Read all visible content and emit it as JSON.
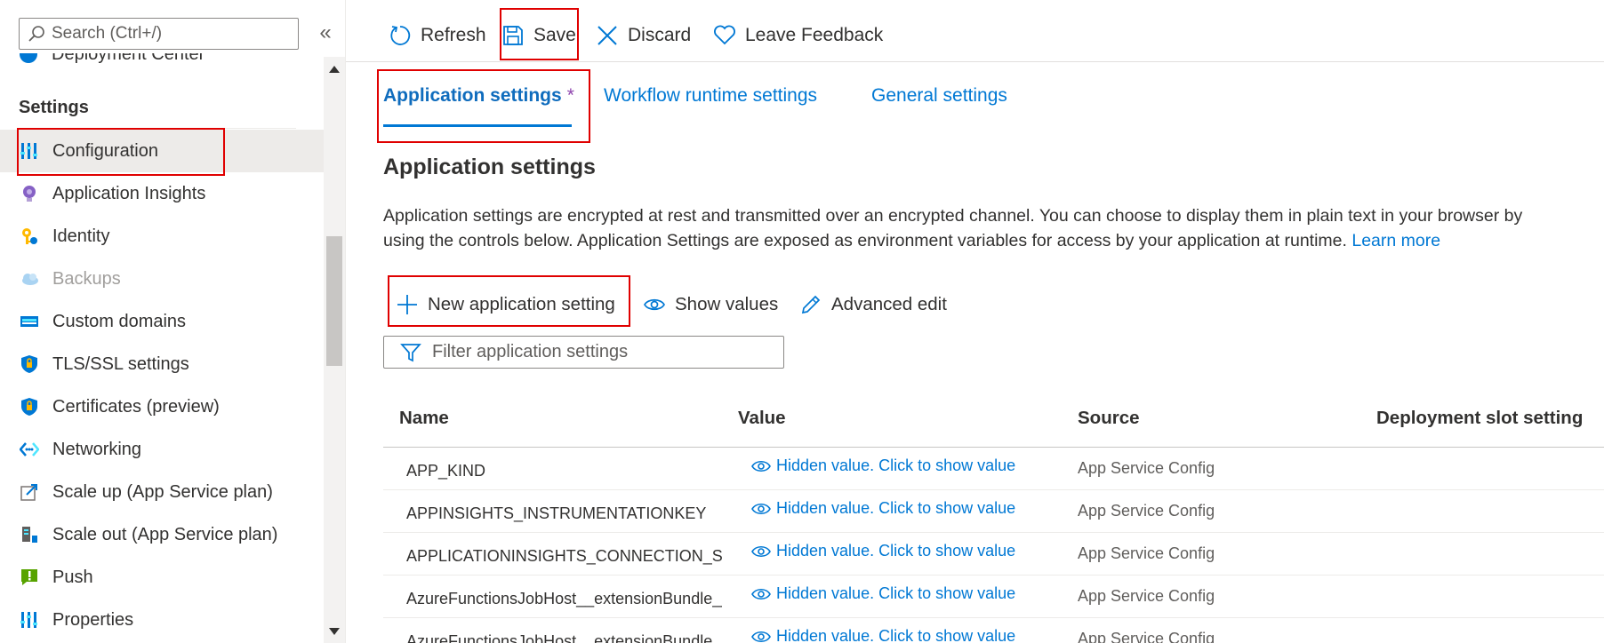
{
  "sidebar": {
    "search_placeholder": "Search (Ctrl+/)",
    "collapse_glyph": "«",
    "partial_item": "Deployment Center",
    "section_header": "Settings",
    "items": [
      {
        "label": "Configuration",
        "icon": "configuration-icon",
        "selected": true
      },
      {
        "label": "Application Insights",
        "icon": "lightbulb-icon"
      },
      {
        "label": "Identity",
        "icon": "identity-key-icon"
      },
      {
        "label": "Backups",
        "icon": "cloud-icon",
        "disabled": true
      },
      {
        "label": "Custom domains",
        "icon": "domain-icon"
      },
      {
        "label": "TLS/SSL settings",
        "icon": "shield-icon"
      },
      {
        "label": "Certificates (preview)",
        "icon": "certificate-shield-icon"
      },
      {
        "label": "Networking",
        "icon": "networking-icon"
      },
      {
        "label": "Scale up (App Service plan)",
        "icon": "scale-up-icon"
      },
      {
        "label": "Scale out (App Service plan)",
        "icon": "scale-out-icon"
      },
      {
        "label": "Push",
        "icon": "push-icon"
      },
      {
        "label": "Properties",
        "icon": "properties-icon"
      }
    ]
  },
  "toolbar": {
    "refresh": "Refresh",
    "save": "Save",
    "discard": "Discard",
    "feedback": "Leave Feedback"
  },
  "tabs": [
    {
      "label": "Application settings",
      "active": true,
      "modified_marker": "*"
    },
    {
      "label": "Workflow runtime settings"
    },
    {
      "label": "General settings"
    }
  ],
  "main": {
    "title": "Application settings",
    "description_line1": "Application settings are encrypted at rest and transmitted over an encrypted channel. You can choose to display them in plain text in your browser by",
    "description_line2": "using the controls below. Application Settings are exposed as environment variables for access by your application at runtime.",
    "learn_more": "Learn more",
    "actions": {
      "new_setting": "New application setting",
      "show_values": "Show values",
      "advanced_edit": "Advanced edit"
    },
    "filter_placeholder": "Filter application settings"
  },
  "table": {
    "columns": [
      "Name",
      "Value",
      "Source",
      "Deployment slot setting"
    ],
    "rows": [
      {
        "name": "APP_KIND",
        "value": "Hidden value. Click to show value",
        "source": "App Service Config"
      },
      {
        "name": "APPINSIGHTS_INSTRUMENTATIONKEY",
        "value": "Hidden value. Click to show value",
        "source": "App Service Config"
      },
      {
        "name": "APPLICATIONINSIGHTS_CONNECTION_STRING",
        "value": "Hidden value. Click to show value",
        "source": "App Service Config"
      },
      {
        "name": "AzureFunctionsJobHost__extensionBundle__id",
        "value": "Hidden value. Click to show value",
        "source": "App Service Config"
      },
      {
        "name": "AzureFunctionsJobHost__extensionBundle__version",
        "value": "Hidden value. Click to show value",
        "source": "App Service Config"
      }
    ]
  },
  "colors": {
    "accent": "#0078d4",
    "highlight_box": "#e00000",
    "modified_star": "#8e44ad"
  }
}
